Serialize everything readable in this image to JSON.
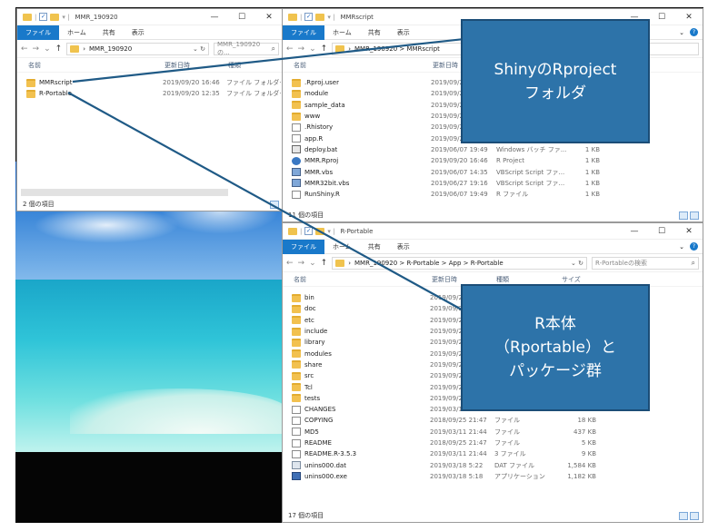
{
  "colors": {
    "accent": "#1979ca",
    "callout_bg": "#2d73a9",
    "callout_border": "#1b4d77",
    "folder": "#f2c14f",
    "connector": "#1f5a86"
  },
  "ribbon": {
    "file": "ファイル",
    "home": "ホーム",
    "share": "共有",
    "view": "表示"
  },
  "window_controls": {
    "minimize": "—",
    "maximize": "☐",
    "close": "✕"
  },
  "columns": {
    "name": "名前",
    "date": "更新日時",
    "type": "種類",
    "size": "サイズ"
  },
  "win1": {
    "title": "MMR_190920",
    "address": "MMR_190920",
    "search_placeholder": "MMR_190920の...",
    "items": [
      {
        "name": "MMRscript",
        "date": "2019/09/20 16:46",
        "type": "ファイル フォルダー",
        "icon": "folder-icon"
      },
      {
        "name": "R-Portable",
        "date": "2019/09/20 12:35",
        "type": "ファイル フォルダー",
        "icon": "folder-icon"
      }
    ],
    "status": "2 個の項目"
  },
  "win2": {
    "title": "MMRscript",
    "address": "MMR_190920 > MMRscript",
    "items": [
      {
        "name": ".Rproj.user",
        "date": "2019/09/20",
        "type": "",
        "size": "",
        "icon": "folder-icon"
      },
      {
        "name": "module",
        "date": "2019/09/20",
        "type": "",
        "size": "",
        "icon": "folder-icon"
      },
      {
        "name": "sample_data",
        "date": "2019/09/20",
        "type": "",
        "size": "",
        "icon": "folder-icon"
      },
      {
        "name": "www",
        "date": "2019/09/20",
        "type": "",
        "size": "",
        "icon": "folder-icon"
      },
      {
        "name": ".Rhistory",
        "date": "2019/09/20",
        "type": "",
        "size": "",
        "icon": "file-icon"
      },
      {
        "name": "app.R",
        "date": "2019/09/20",
        "type": "",
        "size": "",
        "icon": "file-icon"
      },
      {
        "name": "deploy.bat",
        "date": "2019/06/07 19:49",
        "type": "Windows バッチ ファ...",
        "size": "1 KB",
        "icon": "bat-icon"
      },
      {
        "name": "MMR.Rproj",
        "date": "2019/09/20 16:46",
        "type": "R Project",
        "size": "1 KB",
        "icon": "rproj-icon"
      },
      {
        "name": "MMR.vbs",
        "date": "2019/06/07 14:35",
        "type": "VBScript Script ファ...",
        "size": "1 KB",
        "icon": "vbs-icon"
      },
      {
        "name": "MMR32bit.vbs",
        "date": "2019/06/27 19:16",
        "type": "VBScript Script ファ...",
        "size": "1 KB",
        "icon": "vbs-icon"
      },
      {
        "name": "RunShiny.R",
        "date": "2019/06/07 19:49",
        "type": "R ファイル",
        "size": "1 KB",
        "icon": "file-icon"
      }
    ],
    "status": "11 個の項目"
  },
  "win3": {
    "title": "R-Portable",
    "address": "MMR_190920 > R-Portable > App > R-Portable",
    "search_placeholder": "R-Portableの検索",
    "items": [
      {
        "name": "bin",
        "date": "2019/09/20",
        "type": "",
        "size": "",
        "icon": "folder-icon"
      },
      {
        "name": "doc",
        "date": "2019/09/20",
        "type": "",
        "size": "",
        "icon": "folder-icon"
      },
      {
        "name": "etc",
        "date": "2019/09/20",
        "type": "",
        "size": "",
        "icon": "folder-icon"
      },
      {
        "name": "include",
        "date": "2019/09/20",
        "type": "",
        "size": "",
        "icon": "folder-icon"
      },
      {
        "name": "library",
        "date": "2019/09/20",
        "type": "",
        "size": "",
        "icon": "folder-icon"
      },
      {
        "name": "modules",
        "date": "2019/09/20",
        "type": "",
        "size": "",
        "icon": "folder-icon"
      },
      {
        "name": "share",
        "date": "2019/09/20",
        "type": "",
        "size": "",
        "icon": "folder-icon"
      },
      {
        "name": "src",
        "date": "2019/09/20",
        "type": "",
        "size": "",
        "icon": "folder-icon"
      },
      {
        "name": "Tcl",
        "date": "2019/09/20",
        "type": "",
        "size": "",
        "icon": "folder-icon"
      },
      {
        "name": "tests",
        "date": "2019/09/20",
        "type": "",
        "size": "",
        "icon": "folder-icon"
      },
      {
        "name": "CHANGES",
        "date": "2019/03/11",
        "type": "",
        "size": "",
        "icon": "file-icon"
      },
      {
        "name": "COPYING",
        "date": "2018/09/25 21:47",
        "type": "ファイル",
        "size": "18 KB",
        "icon": "file-icon"
      },
      {
        "name": "MD5",
        "date": "2019/03/11 21:44",
        "type": "ファイル",
        "size": "437 KB",
        "icon": "file-icon"
      },
      {
        "name": "README",
        "date": "2018/09/25 21:47",
        "type": "ファイル",
        "size": "5 KB",
        "icon": "file-icon"
      },
      {
        "name": "README.R-3.5.3",
        "date": "2019/03/11 21:44",
        "type": "3 ファイル",
        "size": "9 KB",
        "icon": "file-icon"
      },
      {
        "name": "unins000.dat",
        "date": "2019/03/18 5:22",
        "type": "DAT ファイル",
        "size": "1,584 KB",
        "icon": "dat-icon"
      },
      {
        "name": "unins000.exe",
        "date": "2019/03/18 5:18",
        "type": "アプリケーション",
        "size": "1,182 KB",
        "icon": "exe-icon"
      }
    ],
    "status": "17 個の項目"
  },
  "callouts": {
    "shiny": "ShinyのRproject\nフォルダ",
    "r": "R本体\n（Rportable）と\nパッケージ群"
  }
}
